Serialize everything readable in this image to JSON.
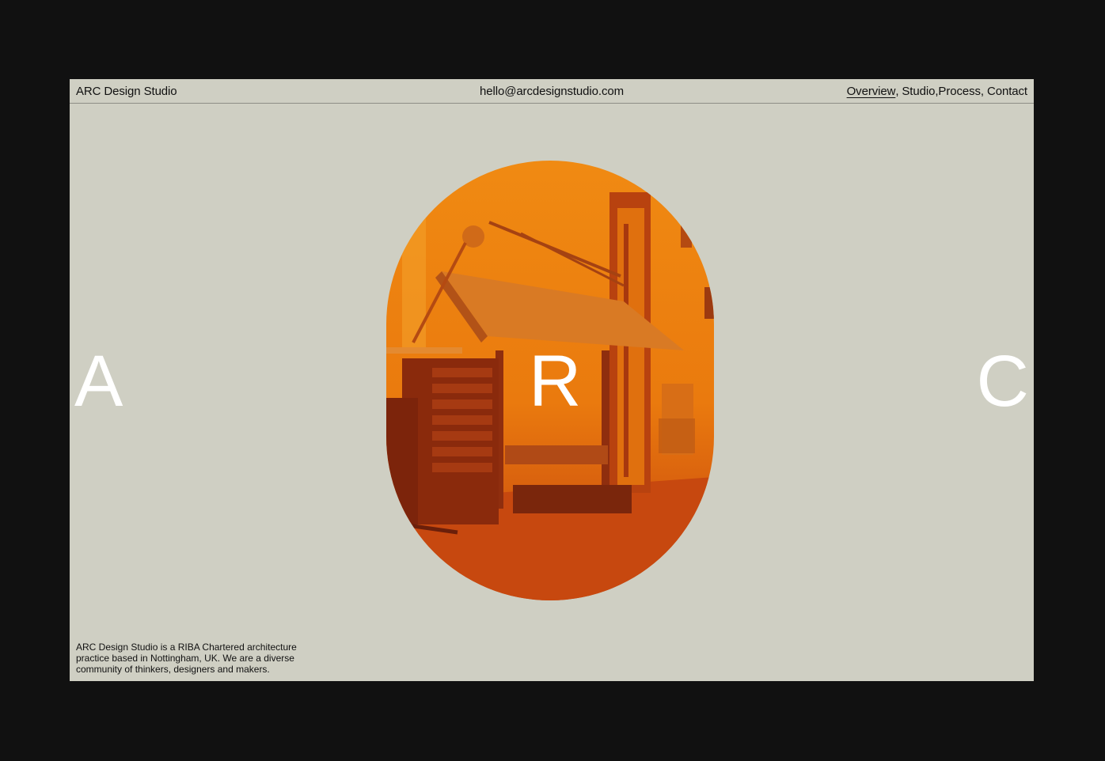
{
  "header": {
    "brand": "ARC Design Studio",
    "email": "hello@arcdesignstudio.com",
    "nav": [
      {
        "label": "Overview",
        "active": true
      },
      {
        "label": "Studio",
        "active": false
      },
      {
        "label": "Process",
        "active": false
      },
      {
        "label": "Contact",
        "active": false
      }
    ],
    "nav_separator": ","
  },
  "hero": {
    "letters": [
      "A",
      "R",
      "C"
    ],
    "image_icon": "studio-drafting-table-photo"
  },
  "footer": {
    "about": "ARC Design Studio is a RIBA Chartered architecture practice based in Nottingham, UK. We are a diverse community of thinkers, designers and makers."
  },
  "colors": {
    "page_background": "#111111",
    "frame_background": "#cfcfc3",
    "accent_orange": "#e8780c",
    "accent_deep": "#b33a10",
    "text": "#111111",
    "hero_letters": "#ffffff"
  }
}
